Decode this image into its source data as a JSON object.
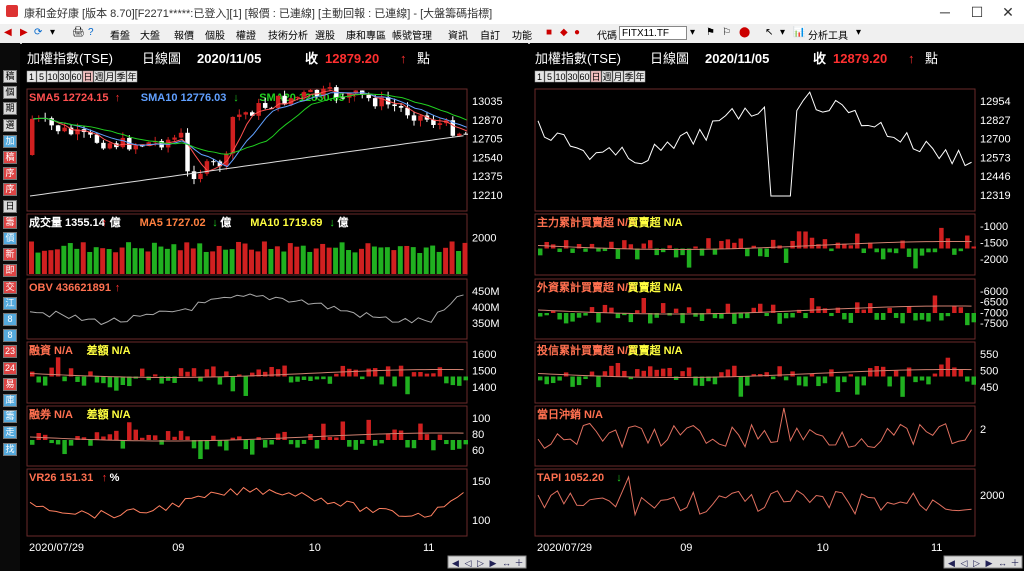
{
  "window": {
    "title": "康和金好康 [版本 8.70][F2271*****:已登入][1] [報價 : 已連線] [主動回報 : 已連線] - [大盤籌碼指標]"
  },
  "toolbar": {
    "items": [
      "看盤",
      "大盤",
      "報價",
      "個股",
      "權證",
      "技術分析",
      "選股",
      "康和專區",
      "帳號管理",
      "資訊",
      "自訂",
      "功能"
    ],
    "code_label": "代碼",
    "code_value": "FITX11.TF",
    "analysis_tools": "分析工具"
  },
  "sidebar": {
    "items": [
      "稿",
      "個",
      "期",
      "選",
      "加",
      "稿",
      "序",
      "序",
      "日",
      "籌",
      "價",
      "新",
      "即",
      "交",
      "江",
      "8",
      "8",
      "23",
      "24",
      "易",
      "庫",
      "籌",
      "走",
      "找"
    ]
  },
  "charts": [
    {
      "header": {
        "name": "加權指數(TSE)",
        "period": "日線圖",
        "date": "2020/11/05",
        "close_label": "收",
        "close_value": "12879.20",
        "arrow": "↑",
        "unit": "點"
      },
      "period_buttons": [
        "1",
        "5",
        "10",
        "30",
        "60",
        "日",
        "週",
        "月",
        "季",
        "年"
      ],
      "panels": [
        {
          "legend": [
            {
              "text": "SMA5 12724.15",
              "arrow": "↑",
              "color": "#ff5050"
            },
            {
              "text": "SMA10 12776.03",
              "arrow": "↓",
              "color": "#60a0ff"
            },
            {
              "text": "SMA20 12830.65",
              "arrow": "↑",
              "color": "#20d020"
            }
          ],
          "axis": [
            "13035",
            "12870",
            "12705",
            "12540",
            "12375",
            "12210"
          ]
        },
        {
          "legend": [
            {
              "text": "成交量 1355.14",
              "arrow": "↑",
              "suffix": "億",
              "color": "#ffffff"
            },
            {
              "text": "MA5 1727.02",
              "arrow": "↓",
              "suffix": "億",
              "color": "#ff8040"
            },
            {
              "text": "MA10 1719.69",
              "arrow": "↓",
              "suffix": "億",
              "color": "#ffff40"
            }
          ],
          "axis": [
            "2000"
          ]
        },
        {
          "legend": [
            {
              "text": "OBV 436621891",
              "arrow": "↑",
              "color": "#ff7050"
            }
          ],
          "axis": [
            "450M",
            "400M",
            "350M"
          ]
        },
        {
          "legend": [
            {
              "text": "融資 N/A",
              "color": "#ff7050"
            },
            {
              "text": "差額 N/A",
              "color": "#ffff40"
            }
          ],
          "axis": [
            "1600",
            "1500",
            "1400"
          ]
        },
        {
          "legend": [
            {
              "text": "融券 N/A",
              "color": "#ff7050"
            },
            {
              "text": "差額 N/A",
              "color": "#ffff40"
            }
          ],
          "axis": [
            "100",
            "80",
            "60"
          ]
        },
        {
          "legend": [
            {
              "text": "VR26 151.31",
              "arrow": "↑",
              "suffix": "%",
              "color": "#ff7050"
            }
          ],
          "axis": [
            "150",
            "100"
          ]
        }
      ],
      "dates": [
        "2020/07/29",
        "09",
        "10",
        "11"
      ]
    },
    {
      "header": {
        "name": "加權指數(TSE)",
        "period": "日線圖",
        "date": "2020/11/05",
        "close_label": "收",
        "close_value": "12879.20",
        "arrow": "↑",
        "unit": "點"
      },
      "period_buttons": [
        "1",
        "5",
        "10",
        "30",
        "60",
        "日",
        "週",
        "月",
        "季",
        "年"
      ],
      "panels": [
        {
          "legend": [],
          "axis": [
            "12954",
            "12827",
            "12700",
            "12573",
            "12446",
            "12319"
          ]
        },
        {
          "legend": [
            {
              "text": "主力累計買賣超 N/A",
              "color": "#ff7050"
            },
            {
              "text": "買賣超 N/A",
              "color": "#ffff40"
            }
          ],
          "axis": [
            "-1000",
            "-1500",
            "-2000"
          ]
        },
        {
          "legend": [
            {
              "text": "外資累計買賣超 N/A",
              "color": "#ff7050"
            },
            {
              "text": "買賣超 N/A",
              "color": "#ffff40"
            }
          ],
          "axis": [
            "-6000",
            "-6500",
            "-7000",
            "-7500"
          ]
        },
        {
          "legend": [
            {
              "text": "投信累計買賣超 N/A",
              "color": "#ff7050"
            },
            {
              "text": "買賣超 N/A",
              "color": "#ffff40"
            }
          ],
          "axis": [
            "550",
            "500",
            "450"
          ]
        },
        {
          "legend": [
            {
              "text": "當日沖銷 N/A",
              "color": "#ff7050"
            }
          ],
          "axis": [
            "2"
          ]
        },
        {
          "legend": [
            {
              "text": "TAPI 1052.20",
              "arrow": "↓",
              "color": "#ff7050"
            }
          ],
          "axis": [
            "2000"
          ]
        }
      ],
      "dates": [
        "2020/07/29",
        "09",
        "10",
        "11"
      ]
    }
  ],
  "colors": {
    "up": "#d02020",
    "down": "#20b020",
    "grid": "#6a2a2a",
    "line": "#ffffff"
  }
}
